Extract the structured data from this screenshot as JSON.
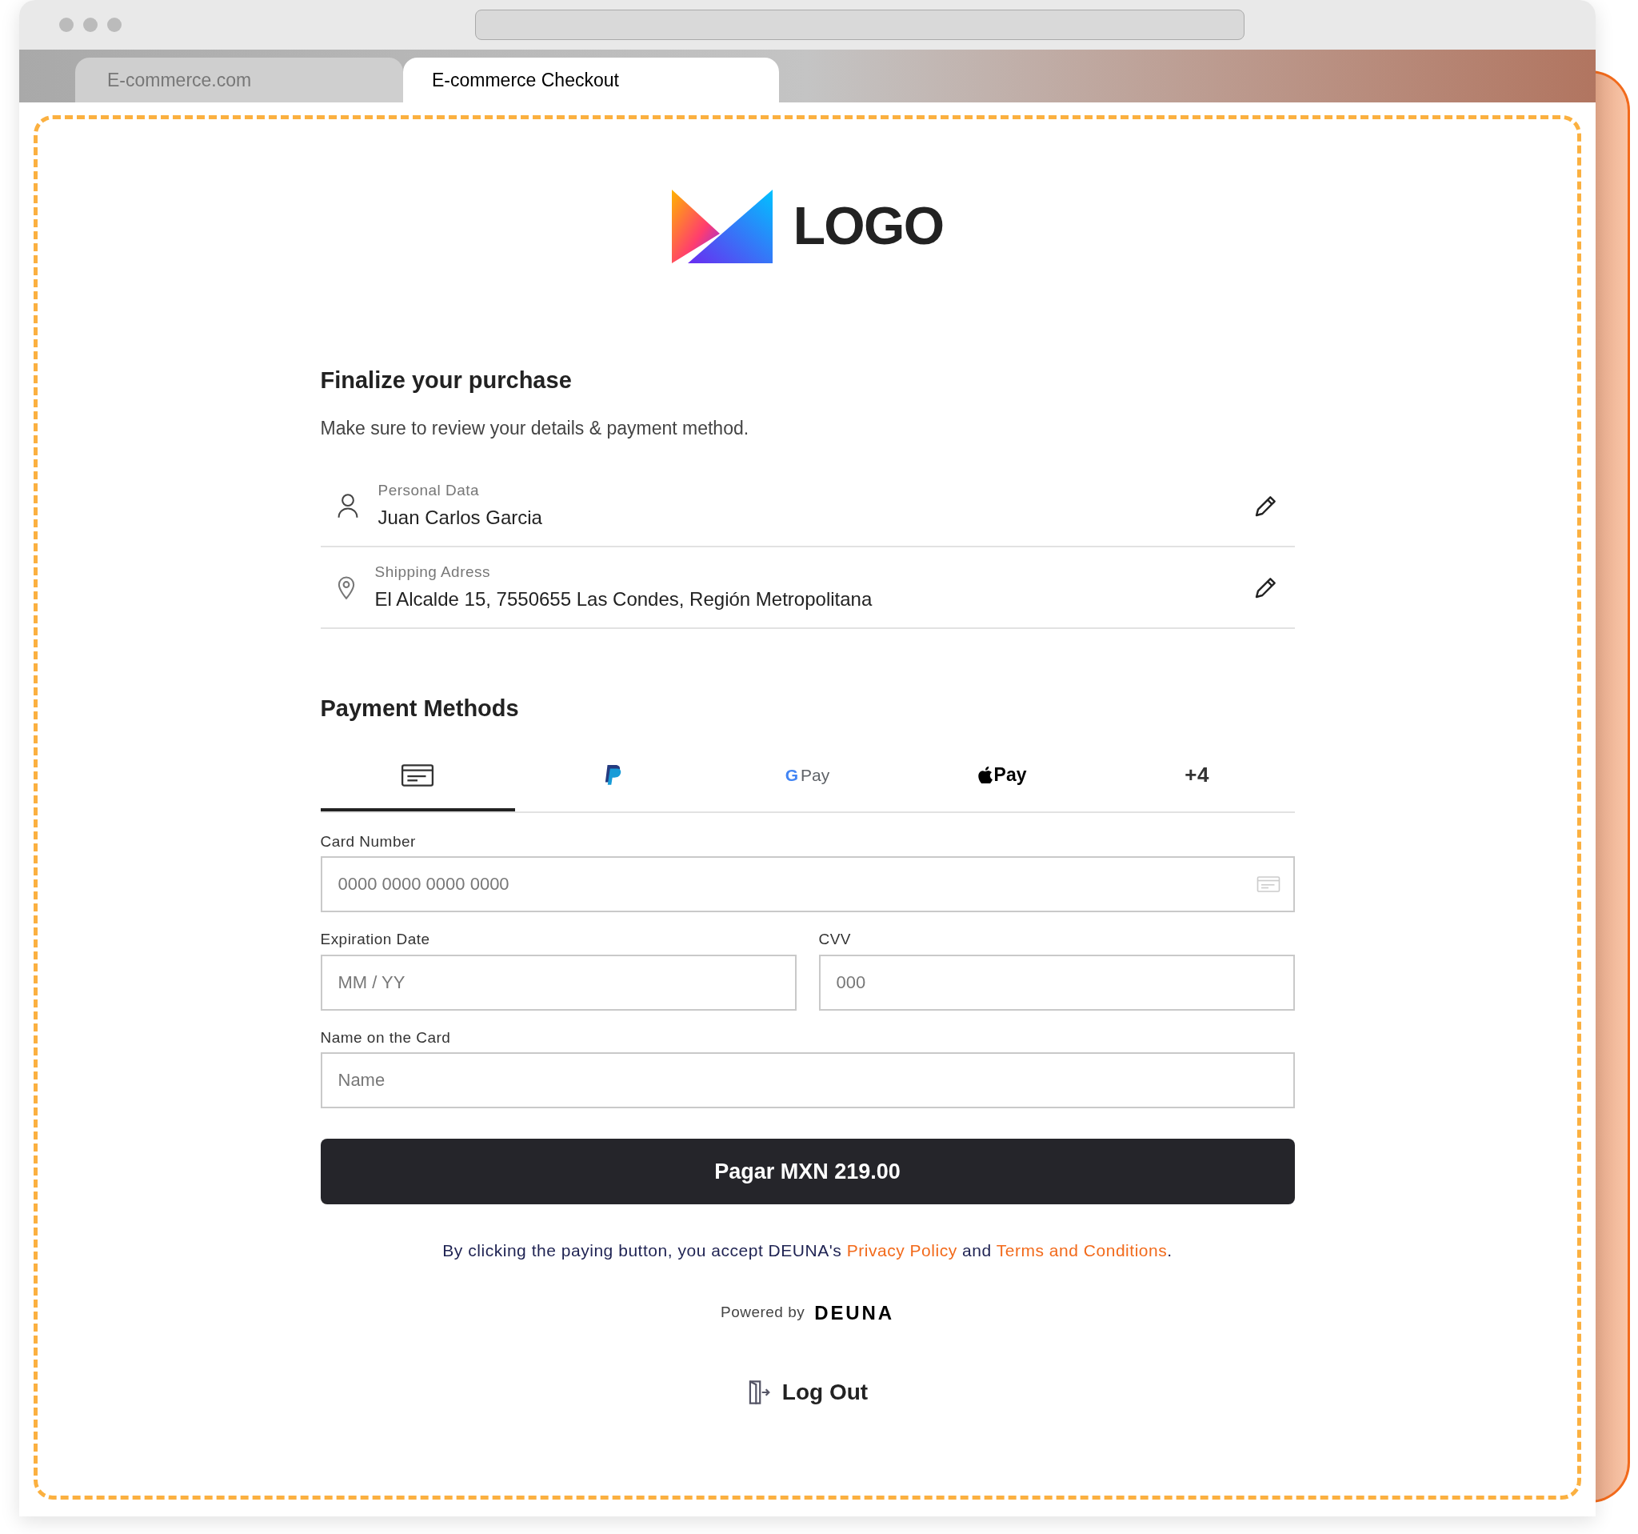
{
  "browser_tabs": [
    {
      "label": "E-commerce.com",
      "selected": false
    },
    {
      "label": "E-commerce Checkout",
      "selected": true
    }
  ],
  "logo": {
    "text": "LOGO"
  },
  "heading": "Finalize your purchase",
  "subtitle": "Make sure to review your details & payment method.",
  "details": [
    {
      "kind": "person",
      "label": "Personal Data",
      "value": "Juan Carlos Garcia"
    },
    {
      "kind": "location",
      "label": "Shipping Adress",
      "value": "El Alcalde 15, 7550655 Las Condes, Región Metropolitana"
    }
  ],
  "payment_heading": "Payment Methods",
  "payment_tabs": [
    {
      "kind": "card",
      "selected": true
    },
    {
      "kind": "paypal",
      "selected": false
    },
    {
      "kind": "gpay",
      "mark": "G",
      "label": "Pay",
      "selected": false
    },
    {
      "kind": "applepay",
      "label": "Pay",
      "selected": false
    },
    {
      "kind": "more",
      "label": "+4",
      "selected": false
    }
  ],
  "fields": [
    {
      "label": "Card Number",
      "placeholder": "0000 0000 0000 0000",
      "card_icon": true
    },
    {
      "label": "Expiration Date",
      "placeholder": "MM / YY",
      "card_icon": false
    },
    {
      "label": "CVV",
      "placeholder": "000",
      "card_icon": false
    },
    {
      "label": "Name on the Card",
      "placeholder": "Name",
      "card_icon": false
    }
  ],
  "pay_button": "Pagar MXN 219.00",
  "terms": {
    "before": "By clicking the paying button, you accept DEUNA's ",
    "privacy": "Privacy Policy",
    "middle": " and ",
    "conditions": "Terms and Conditions",
    "after": "."
  },
  "powered_by": {
    "text": "Powered by",
    "brand": "DEUNA"
  },
  "logout": "Log Out"
}
